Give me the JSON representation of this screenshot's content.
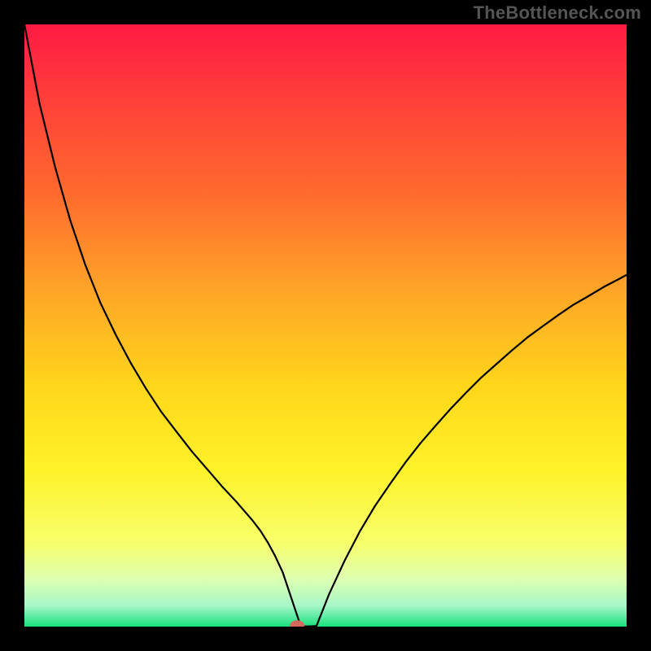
{
  "watermark": "TheBottleneck.com",
  "chart_data": {
    "type": "line",
    "title": "",
    "xlabel": "",
    "ylabel": "",
    "xlim": [
      0,
      100
    ],
    "ylim": [
      0,
      100
    ],
    "grid": false,
    "legend": false,
    "annotations": [],
    "background_gradient": {
      "stops": [
        {
          "pos": 0.0,
          "color": "#ff1a44"
        },
        {
          "pos": 0.12,
          "color": "#ff3e3a"
        },
        {
          "pos": 0.28,
          "color": "#ff6a2e"
        },
        {
          "pos": 0.44,
          "color": "#ffa428"
        },
        {
          "pos": 0.6,
          "color": "#ffd61a"
        },
        {
          "pos": 0.74,
          "color": "#fff22a"
        },
        {
          "pos": 0.86,
          "color": "#f7ff6a"
        },
        {
          "pos": 0.92,
          "color": "#dfffb0"
        },
        {
          "pos": 0.965,
          "color": "#a8f7c8"
        },
        {
          "pos": 1.0,
          "color": "#19e07e"
        }
      ]
    },
    "series": [
      {
        "name": "curve",
        "stroke": "#000000",
        "stroke_width": 2.2,
        "x": [
          0.0,
          2.5,
          5.1,
          7.6,
          10.1,
          12.6,
          15.2,
          17.7,
          20.2,
          22.7,
          25.3,
          27.8,
          30.3,
          32.8,
          35.4,
          37.9,
          39.2,
          40.4,
          41.6,
          42.9,
          45.9,
          47.2,
          48.5,
          50.6,
          53.2,
          55.7,
          58.2,
          60.8,
          63.3,
          65.8,
          68.4,
          70.9,
          73.4,
          75.9,
          78.5,
          81.0,
          83.5,
          86.1,
          88.6,
          91.1,
          93.7,
          96.2,
          98.7,
          100.0
        ],
        "y": [
          100.0,
          86.9,
          76.3,
          67.5,
          60.1,
          53.8,
          48.4,
          43.7,
          39.5,
          35.7,
          32.3,
          29.1,
          26.2,
          23.3,
          20.5,
          17.6,
          15.9,
          14.0,
          11.8,
          9.0,
          0.03,
          0.03,
          0.1,
          5.4,
          11.0,
          15.8,
          20.0,
          23.8,
          27.3,
          30.5,
          33.5,
          36.3,
          38.9,
          41.4,
          43.7,
          45.9,
          48.0,
          49.9,
          51.7,
          53.4,
          54.9,
          56.4,
          57.7,
          58.4
        ]
      }
    ],
    "marker": {
      "name": "marker",
      "x": 45.3,
      "y": 0.2,
      "rx": 1.2,
      "ry": 0.85,
      "fill": "#d46a5e"
    }
  }
}
